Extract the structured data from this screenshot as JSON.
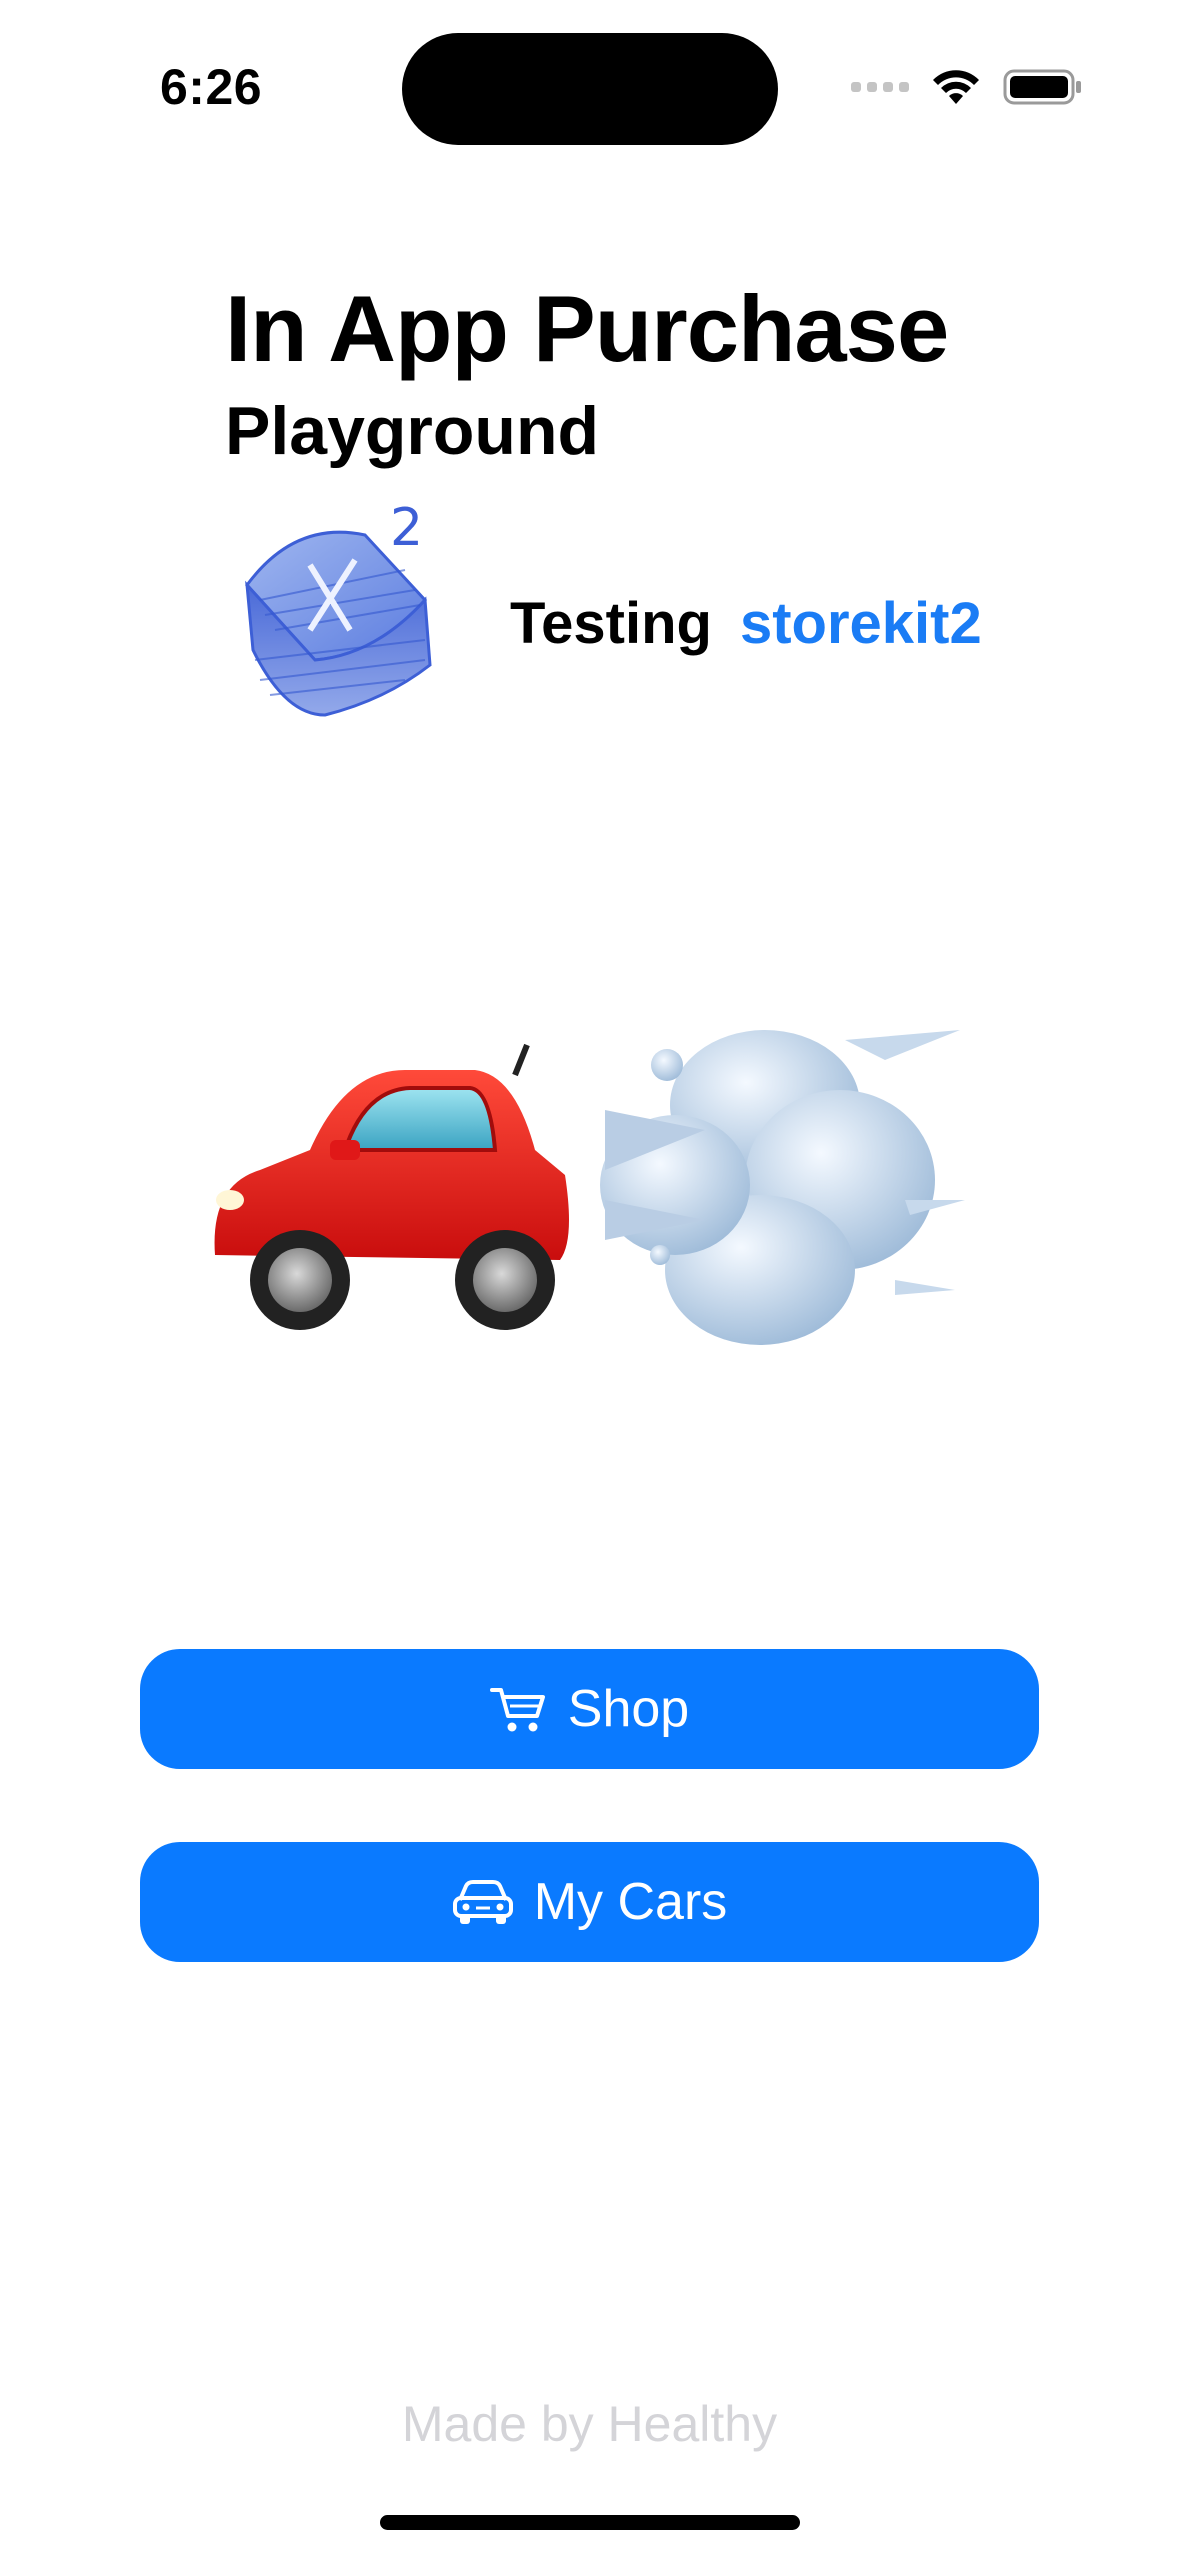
{
  "status_bar": {
    "time": "6:26"
  },
  "header": {
    "title": "In App Purchase",
    "subtitle": "Playground"
  },
  "tagline": {
    "label": "Testing",
    "highlight": "storekit2",
    "highlight_color": "#1a7cf5"
  },
  "logo": {
    "icon": "storekit-sketch-icon",
    "superscript": "2"
  },
  "hero": {
    "icons": [
      "red-car-emoji",
      "dashing-away-emoji"
    ]
  },
  "buttons": {
    "shop_label": "Shop",
    "shop_icon": "cart-icon",
    "my_cars_label": "My Cars",
    "my_cars_icon": "car-icon",
    "color": "#0a7aff"
  },
  "footer": {
    "text": "Made by Healthy"
  }
}
